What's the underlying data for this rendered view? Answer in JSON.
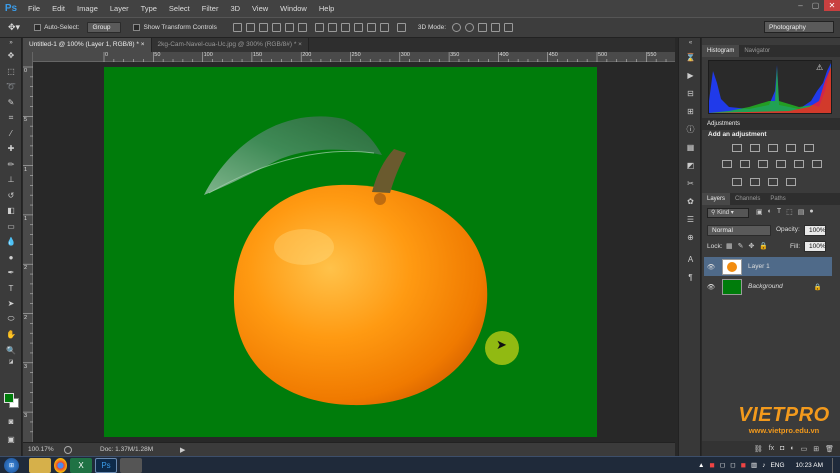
{
  "app": {
    "logo": "Ps"
  },
  "menu": [
    "File",
    "Edit",
    "Image",
    "Layer",
    "Type",
    "Select",
    "Filter",
    "3D",
    "View",
    "Window",
    "Help"
  ],
  "window_controls": [
    "–",
    "▢",
    "✕"
  ],
  "options": {
    "auto_select": "Auto-Select:",
    "auto_select_value": "Group",
    "transform": "Show Transform Controls",
    "mode_3d": "3D Mode:",
    "workspace": "Photography"
  },
  "tabs": [
    {
      "label": "Untitled-1 @ 100% (Layer 1, RGB/8) *",
      "close": "×"
    },
    {
      "label": "2kg-Cam-Navel-cua-Uc.jpg @ 300% (RGB/8#) *",
      "close": "×"
    }
  ],
  "ruler_h": [
    "0",
    "50",
    "100",
    "150",
    "200",
    "250",
    "300",
    "350",
    "400",
    "450",
    "500",
    "550",
    "600",
    "650"
  ],
  "ruler_v": [
    "0",
    "5",
    "1",
    "1",
    "2",
    "2",
    "3",
    "3"
  ],
  "status": {
    "zoom": "100.17%",
    "doc": "Doc: 1.37M/1.28M"
  },
  "histogram": {
    "tabs": [
      "Histogram",
      "Navigator"
    ],
    "warning": "⚠"
  },
  "adjustments": {
    "title": "Adjustments",
    "subtitle": "Add an adjustment"
  },
  "layers": {
    "tabs": [
      "Layers",
      "Channels",
      "Paths"
    ],
    "kind": "Kind",
    "blend": "Normal",
    "opacity_label": "Opacity:",
    "opacity": "100%",
    "lock_label": "Lock:",
    "fill_label": "Fill:",
    "fill": "100%",
    "items": [
      {
        "name": "Layer 1",
        "selected": true
      },
      {
        "name": "Background",
        "selected": false
      }
    ]
  },
  "taskbar": {
    "lang": "ENG",
    "time": "10:23 AM"
  },
  "watermark": {
    "brand": "VIETPRO",
    "url": "www.vietpro.edu.vn"
  },
  "colors": {
    "canvas_green": "#007c0b",
    "brand_orange": "#f39a1c"
  }
}
